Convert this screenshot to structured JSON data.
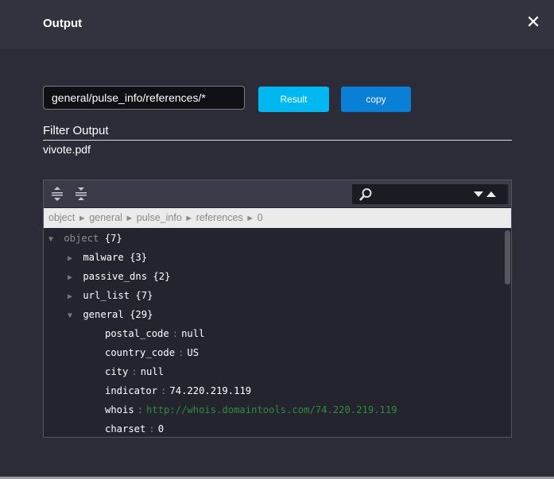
{
  "dialog": {
    "title": "Output",
    "close_glyph": "✕"
  },
  "query": {
    "path_value": "general/pulse_info/references/*",
    "result_label": "Result",
    "copy_label": "copy"
  },
  "filter": {
    "label": "Filter Output",
    "value": "vivote.pdf"
  },
  "viewer": {
    "search_value": "",
    "breadcrumb": [
      "object",
      "general",
      "pulse_info",
      "references",
      "0"
    ],
    "breadcrumb_separator": "►",
    "tree": {
      "root": {
        "key": "object",
        "count": "{7}",
        "expanded": true
      },
      "nodes": [
        {
          "key": "malware",
          "count": "{3}",
          "expanded": false
        },
        {
          "key": "passive_dns",
          "count": "{2}",
          "expanded": false
        },
        {
          "key": "url_list",
          "count": "{7}",
          "expanded": false
        },
        {
          "key": "general",
          "count": "{29}",
          "expanded": true
        }
      ],
      "fields": [
        {
          "key": "postal_code",
          "value": "null"
        },
        {
          "key": "country_code",
          "value": "US"
        },
        {
          "key": "city",
          "value": "null"
        },
        {
          "key": "indicator",
          "value": "74.220.219.119"
        },
        {
          "key": "whois",
          "value": "http://whois.domaintools.com/74.220.219.119"
        },
        {
          "key": "charset",
          "value": "0"
        }
      ]
    }
  },
  "colors": {
    "accent_result": "#00b8f1",
    "accent_copy": "#0a7fd6",
    "link": "#2e8b3f"
  }
}
